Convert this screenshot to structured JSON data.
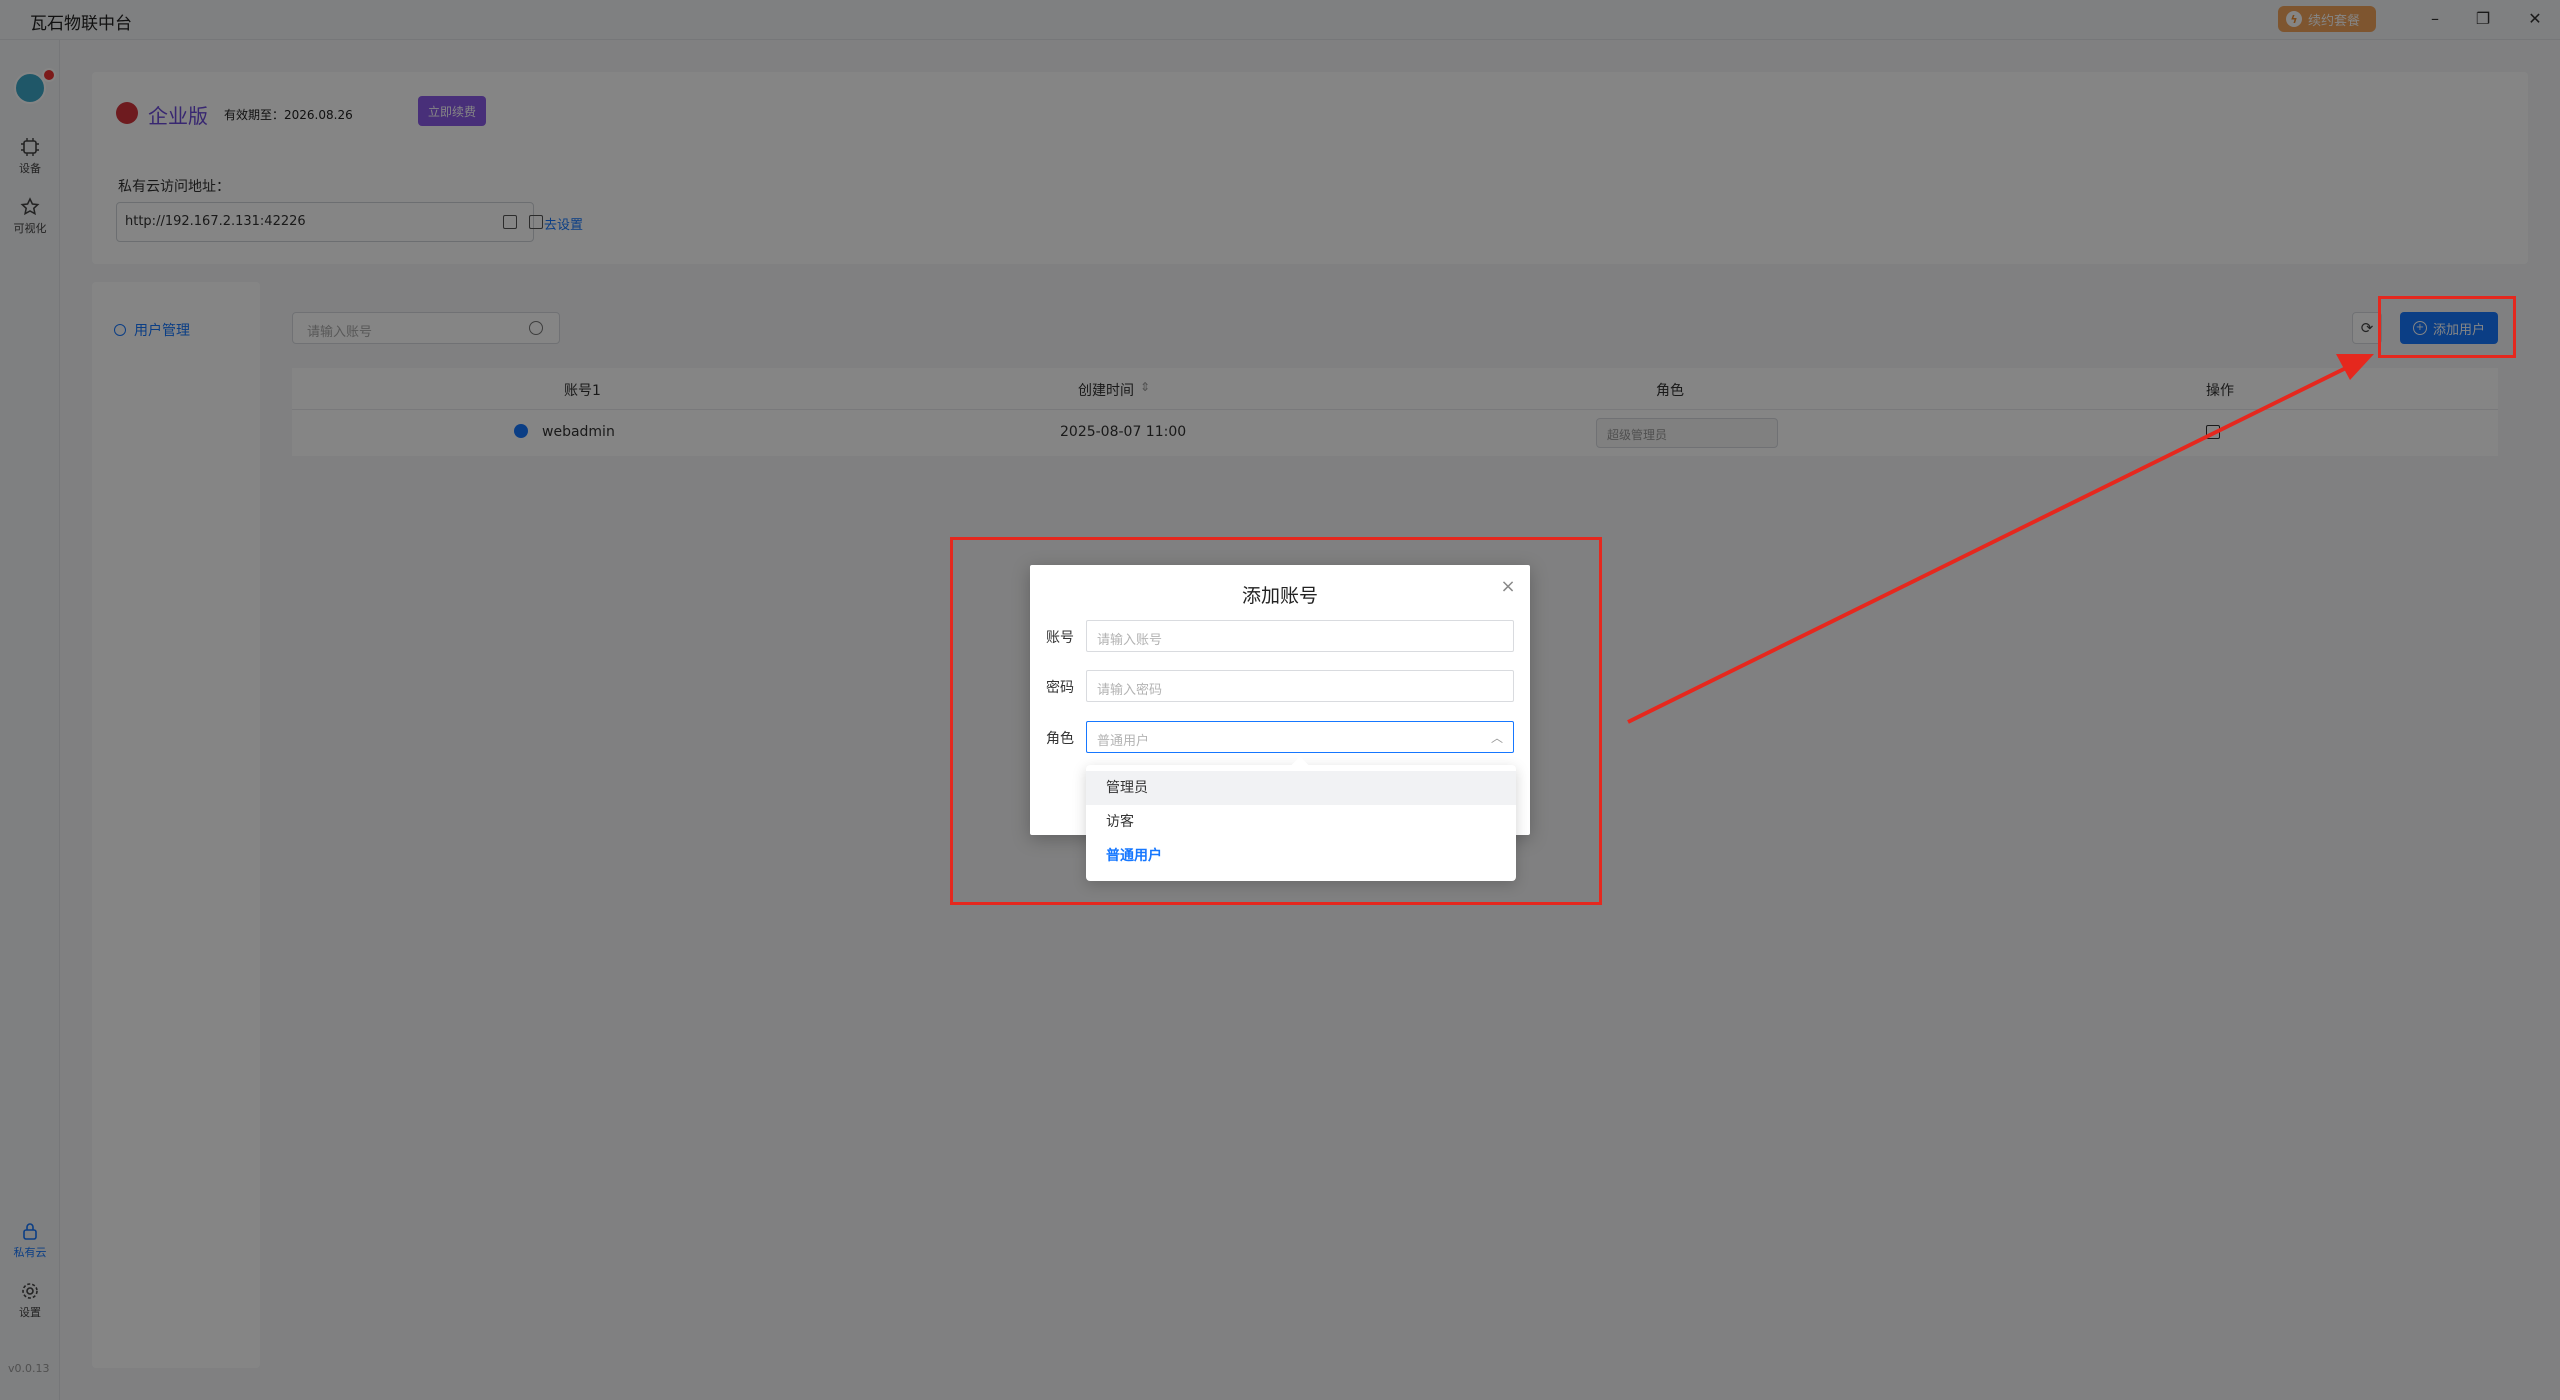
{
  "window": {
    "title": "瓦石物联中台",
    "renew_label": "续约套餐",
    "minimize": "–",
    "maximize": "❐",
    "close": "✕"
  },
  "rail": {
    "items": [
      {
        "label": "设备"
      },
      {
        "label": "可视化"
      },
      {
        "label": "私有云"
      },
      {
        "label": "设置"
      }
    ],
    "version": "v0.0.13"
  },
  "license": {
    "edition": "企业版",
    "expiry": "有效期至：2026.08.26",
    "renew_now": "立即续费",
    "url_label": "私有云访问地址：",
    "url": "http://192.167.2.131:42226",
    "goto_settings": "去设置"
  },
  "side_menu": {
    "user_management": "用户管理"
  },
  "toolbar": {
    "search_placeholder": "请输入账号",
    "refresh_icon": "⟳",
    "add_user": "添加用户"
  },
  "table": {
    "columns": [
      "账号1",
      "创建时间",
      "角色",
      "操作"
    ],
    "sort_icon": "⇕",
    "rows": [
      {
        "account": "webadmin",
        "created": "2025-08-07 11:00",
        "role": "超级管理员"
      }
    ]
  },
  "dialog": {
    "title": "添加账号",
    "close_icon": "×",
    "account_label": "账号",
    "account_placeholder": "请输入账号",
    "password_label": "密码",
    "password_placeholder": "请输入密码",
    "role_label": "角色",
    "role_value": "普通用户",
    "chevron_up": "︿"
  },
  "role_options": [
    {
      "label": "管理员"
    },
    {
      "label": "访客"
    },
    {
      "label": "普通用户"
    }
  ],
  "colors": {
    "accent": "#1677ff",
    "annotation": "#e5281e",
    "edition_purple": "#8a5ae8",
    "renew_orange": "#f2a35a"
  }
}
